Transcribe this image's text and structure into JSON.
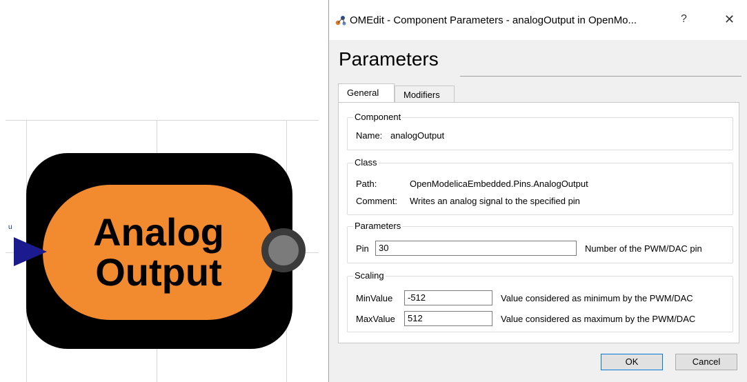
{
  "diagram": {
    "block_line1": "Analog",
    "block_line2": "Output",
    "input_port_label": "u",
    "colors": {
      "block_fill": "#f28a30",
      "block_border": "#000000",
      "input_arrow": "#1b1b8f",
      "output_port": "#7b7b7b"
    }
  },
  "dialog": {
    "title": "OMEdit - Component Parameters - analogOutput in OpenMo...",
    "help_glyph": "?",
    "close_glyph": "✕",
    "heading": "Parameters",
    "tabs": [
      {
        "label": "General",
        "active": true
      },
      {
        "label": "Modifiers",
        "active": false
      }
    ],
    "component": {
      "group_title": "Component",
      "name_label": "Name:",
      "name_value": "analogOutput"
    },
    "class": {
      "group_title": "Class",
      "path_label": "Path:",
      "path_value": "OpenModelicaEmbedded.Pins.AnalogOutput",
      "comment_label": "Comment:",
      "comment_value": "Writes an analog signal to the specified pin"
    },
    "parameters": {
      "group_title": "Parameters",
      "pin_label": "Pin",
      "pin_value": "30",
      "pin_description": "Number of the PWM/DAC pin"
    },
    "scaling": {
      "group_title": "Scaling",
      "min_label": "MinValue",
      "min_value": "-512",
      "min_description": "Value considered as minimum by the PWM/DAC",
      "max_label": "MaxValue",
      "max_value": "512",
      "max_description": "Value considered as maximum by the PWM/DAC"
    },
    "buttons": {
      "ok": "OK",
      "cancel": "Cancel"
    },
    "icons": {
      "app": "openmodelica-app-icon",
      "help": "help-icon",
      "close": "close-icon"
    }
  }
}
